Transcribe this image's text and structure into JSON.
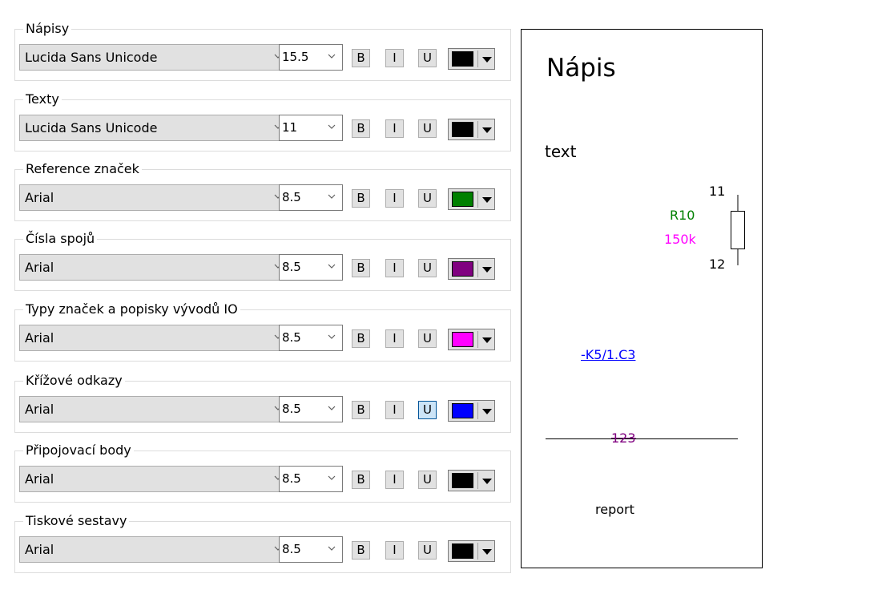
{
  "groups": [
    {
      "label": "Nápisy",
      "font": "Lucida Sans Unicode",
      "size": "15.5",
      "bold": "B",
      "italic": "I",
      "underline": "U",
      "underline_active": false,
      "color": "#000000"
    },
    {
      "label": "Texty",
      "font": "Lucida Sans Unicode",
      "size": "11",
      "bold": "B",
      "italic": "I",
      "underline": "U",
      "underline_active": false,
      "color": "#000000"
    },
    {
      "label": "Reference značek",
      "font": "Arial",
      "size": "8.5",
      "bold": "B",
      "italic": "I",
      "underline": "U",
      "underline_active": false,
      "color": "#008000"
    },
    {
      "label": "Čísla spojů",
      "font": "Arial",
      "size": "8.5",
      "bold": "B",
      "italic": "I",
      "underline": "U",
      "underline_active": false,
      "color": "#800080"
    },
    {
      "label": "Typy značek a popisky vývodů IO",
      "font": "Arial",
      "size": "8.5",
      "bold": "B",
      "italic": "I",
      "underline": "U",
      "underline_active": false,
      "color": "#ff00ff"
    },
    {
      "label": "Křížové odkazy",
      "font": "Arial",
      "size": "8.5",
      "bold": "B",
      "italic": "I",
      "underline": "U",
      "underline_active": true,
      "color": "#0000ff"
    },
    {
      "label": "Připojovací body",
      "font": "Arial",
      "size": "8.5",
      "bold": "B",
      "italic": "I",
      "underline": "U",
      "underline_active": false,
      "color": "#000000"
    },
    {
      "label": "Tiskové sestavy",
      "font": "Arial",
      "size": "8.5",
      "bold": "B",
      "italic": "I",
      "underline": "U",
      "underline_active": false,
      "color": "#000000"
    }
  ],
  "preview": {
    "title": "Nápis",
    "text": "text",
    "pin_top": "11",
    "ref": "R10",
    "value": "150k",
    "pin_bottom": "12",
    "cross_ref": "-K5/1.C3",
    "wire_number": "123",
    "report": "report",
    "colors": {
      "ref": "#008000",
      "value": "#ff00ff",
      "cross_ref": "#0000ff",
      "wire_number": "#800080"
    }
  }
}
